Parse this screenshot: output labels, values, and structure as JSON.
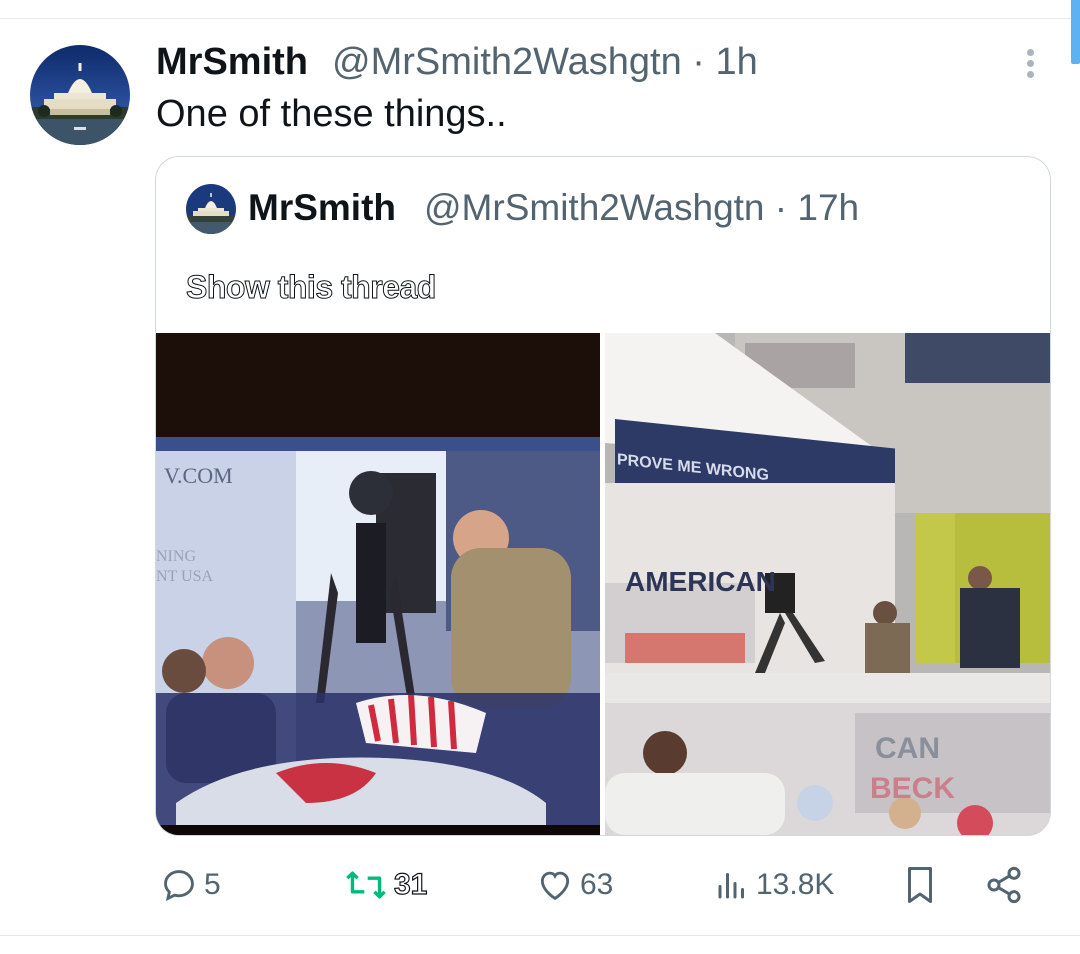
{
  "tweet": {
    "author_name": "MrSmith",
    "handle_time": "@MrSmith2Washgtn · 1h",
    "text": "One of these things.."
  },
  "quote": {
    "author_name": "MrSmith",
    "handle_time": "@MrSmith2Washgtn · 17h",
    "show_thread": "Show this thread"
  },
  "images": {
    "left_text": [
      "V.COM",
      "NING",
      "NT USA"
    ],
    "right_text": [
      "AMERICAN",
      "PROVE ME WRONG",
      "CAN",
      "BECK"
    ]
  },
  "actions": {
    "replies": "5",
    "reposts": "31",
    "likes": "63",
    "views": "13.8K"
  },
  "icons": [
    "reply-icon",
    "repost-icon",
    "like-icon",
    "views-icon",
    "bookmark-icon",
    "share-icon",
    "more-icon"
  ],
  "colors": {
    "repost_active": "#00ba7c",
    "muted": "#536471",
    "border": "#cfd9de"
  }
}
